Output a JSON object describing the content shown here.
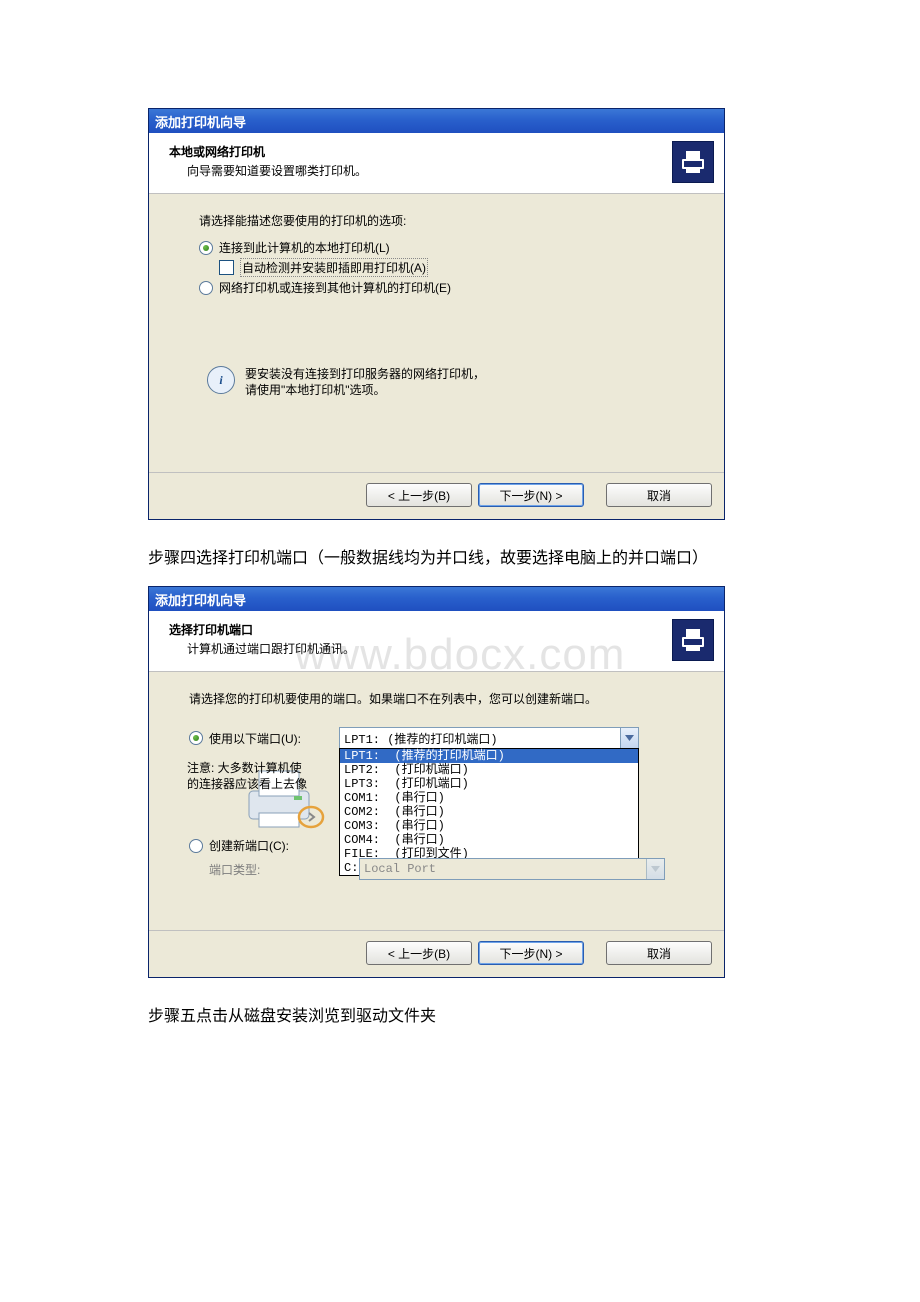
{
  "watermark": "www.bdocx.com",
  "wizard1": {
    "title": "添加打印机向导",
    "headerTitle": "本地或网络打印机",
    "headerSub": "向导需要知道要设置哪类打印机。",
    "prompt": "请选择能描述您要使用的打印机的选项:",
    "radio1": "连接到此计算机的本地打印机(L)",
    "checkbox": "自动检测并安装即插即用打印机(A)",
    "radio2": "网络打印机或连接到其他计算机的打印机(E)",
    "infoLine1": "要安装没有连接到打印服务器的网络打印机，",
    "infoLine2": "请使用\"本地打印机\"选项。",
    "back": "< 上一步(B)",
    "next": "下一步(N) >",
    "cancel": "取消"
  },
  "caption1": "步骤四选择打印机端口（一般数据线均为并口线，故要选择电脑上的并口端口）",
  "wizard2": {
    "title": "添加打印机向导",
    "headerTitle": "选择打印机端口",
    "headerSub": "计算机通过端口跟打印机通讯。",
    "prompt": "请选择您的打印机要使用的端口。如果端口不在列表中，您可以创建新端口。",
    "radioUse": "使用以下端口(U):",
    "comboValue": "LPT1:  (推荐的打印机端口)",
    "noteLine1": "注意: 大多数计算机使",
    "noteLine2": "的连接器应该看上去像",
    "dropdown": [
      {
        "text": "LPT1:  (推荐的打印机端口)",
        "sel": true
      },
      {
        "text": "LPT2:  (打印机端口)"
      },
      {
        "text": "LPT3:  (打印机端口)"
      },
      {
        "text": "COM1:  (串行口)"
      },
      {
        "text": "COM2:  (串行口)"
      },
      {
        "text": "COM3:  (串行口)"
      },
      {
        "text": "COM4:  (串行口)"
      },
      {
        "text": "FILE:  (打印到文件)"
      },
      {
        "text": "C:\\WINDOWS\\HWSealPort (本地端口)"
      }
    ],
    "radioCreate": "创建新端口(C):",
    "portTypeLabel": "端口类型:",
    "portTypeValue": "Local Port",
    "back": "< 上一步(B)",
    "next": "下一步(N) >",
    "cancel": "取消"
  },
  "caption2": "步骤五点击从磁盘安装浏览到驱动文件夹"
}
